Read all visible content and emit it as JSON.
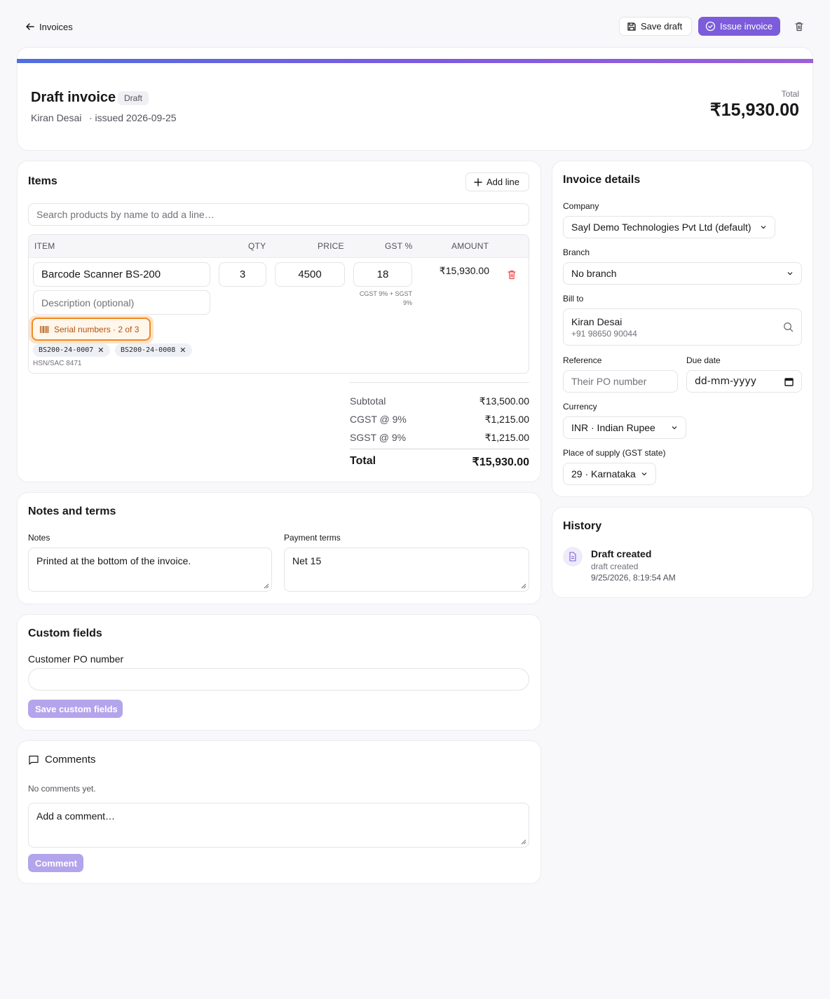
{
  "topbar": {
    "back_label": "Invoices",
    "save_draft_label": "Save draft",
    "issue_label": "Issue invoice"
  },
  "header": {
    "title": "Draft invoice",
    "status_badge": "Draft",
    "customer": "Kiran Desai",
    "issued": "· issued 2026-09-25",
    "total_label": "Total",
    "total_value": "₹15,930.00"
  },
  "items": {
    "title": "Items",
    "add_line_label": "Add line",
    "search_placeholder": "Search products by name to add a line…",
    "columns": {
      "item": "ITEM",
      "qty": "QTY",
      "price": "PRICE",
      "gst": "GST %",
      "amount": "AMOUNT"
    },
    "line": {
      "name": "Barcode Scanner BS-200",
      "description_placeholder": "Description (optional)",
      "qty": "3",
      "price": "4500",
      "gst": "18",
      "gst_split": "CGST 9% + SGST 9%",
      "amount": "₹15,930.00",
      "serial_button": "Serial numbers · 2 of 3",
      "serials": [
        "BS200-24-0007",
        "BS200-24-0008"
      ],
      "hsn": "HSN/SAC 8471"
    },
    "totals": {
      "subtotal_label": "Subtotal",
      "subtotal": "₹13,500.00",
      "cgst_label": "CGST @ 9%",
      "cgst": "₹1,215.00",
      "sgst_label": "SGST @ 9%",
      "sgst": "₹1,215.00",
      "total_label": "Total",
      "total": "₹15,930.00"
    }
  },
  "details": {
    "title": "Invoice details",
    "company_label": "Company",
    "company_value": "Sayl Demo Technologies Pvt Ltd (default)",
    "branch_label": "Branch",
    "branch_value": "No branch",
    "bill_to_label": "Bill to",
    "bill_to_name": "Kiran Desai",
    "bill_to_phone": "+91 98650 90044",
    "reference_label": "Reference",
    "reference_placeholder": "Their PO number",
    "due_label": "Due date",
    "due_placeholder": "dd-mm-yyyy",
    "currency_label": "Currency",
    "currency_value": "INR · Indian Rupee",
    "pos_label": "Place of supply (GST state)",
    "pos_value": "29 · Karnataka"
  },
  "history": {
    "title": "History",
    "event_title": "Draft created",
    "event_sub": "draft created",
    "event_time": "9/25/2026, 8:19:54 AM"
  },
  "notes": {
    "title": "Notes and terms",
    "notes_label": "Notes",
    "notes_placeholder": "Printed at the bottom of the invoice.",
    "terms_label": "Payment terms",
    "terms_value": "Net 15"
  },
  "custom": {
    "title": "Custom fields",
    "po_label": "Customer PO number",
    "save_label": "Save custom fields"
  },
  "comments": {
    "title": "Comments",
    "empty": "No comments yet.",
    "placeholder": "Add a comment…",
    "submit_label": "Comment"
  },
  "colors": {
    "accent": "#7c5cdb",
    "accent_light": "#b3a4ec",
    "serial_orange": "#f08a24",
    "delete_red": "#ef4444"
  }
}
